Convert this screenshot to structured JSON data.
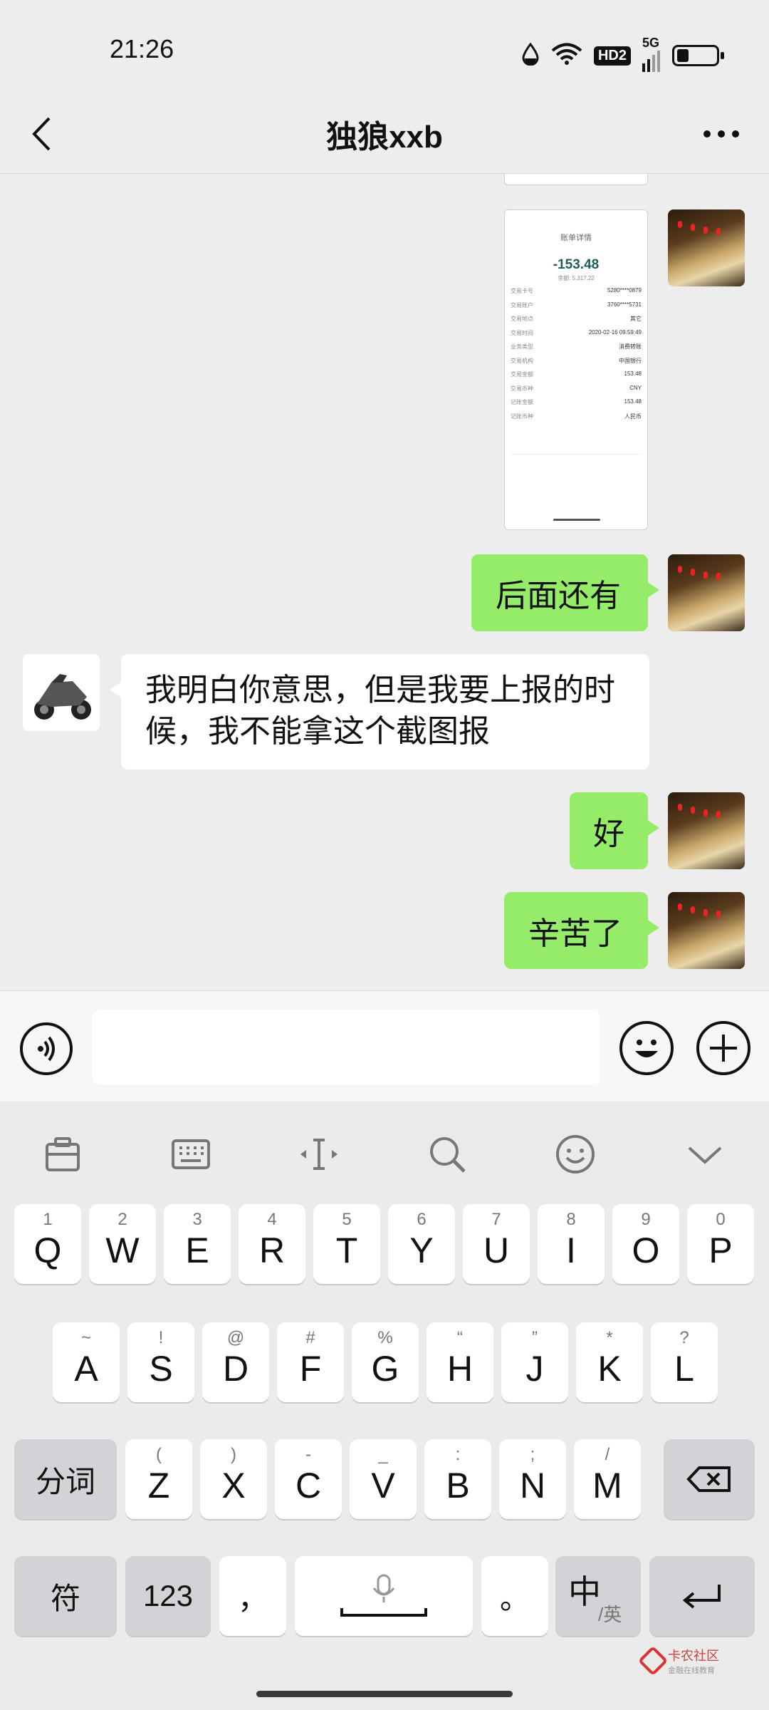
{
  "status_bar": {
    "time": "21:26",
    "hd_badge": "HD2",
    "network": "5G",
    "icons": [
      "drop-icon",
      "wifi-icon",
      "signal-icon",
      "battery-icon"
    ]
  },
  "header": {
    "title": "独狼xxb",
    "back_icon": "chevron-left-icon",
    "more_icon": "more-dots-icon"
  },
  "messages": [
    {
      "from": "me",
      "type": "image",
      "amount": "-153.48",
      "subamount": "余额: 5,317.22"
    },
    {
      "from": "me",
      "type": "text",
      "text": "后面还有"
    },
    {
      "from": "them",
      "type": "text",
      "text_line1": "我明白你意思，但是我要上报的时",
      "text_line2": "候，我不能拿这个截图报"
    },
    {
      "from": "me",
      "type": "text",
      "text": "好"
    },
    {
      "from": "me",
      "type": "text",
      "text": "辛苦了"
    }
  ],
  "screenshot_rows": [
    {
      "label": "交易卡号",
      "value": "5280****0879"
    },
    {
      "label": "交易账户",
      "value": "3760****5731"
    },
    {
      "label": "交易地点",
      "value": "其它"
    },
    {
      "label": "交易时间",
      "value": "2020-02-16 09:59:49"
    },
    {
      "label": "业务类型",
      "value": "消费转账"
    },
    {
      "label": "交易机构",
      "value": "中国银行"
    },
    {
      "label": "交易金额",
      "value": "153.48"
    },
    {
      "label": "交易币种",
      "value": "CNY"
    },
    {
      "label": "记账金额",
      "value": "153.48"
    },
    {
      "label": "记账币种",
      "value": "人民币"
    }
  ],
  "input_bar": {
    "placeholder": "",
    "voice_icon": "voice-icon",
    "emoji_icon": "emoji-icon",
    "plus_icon": "plus-icon"
  },
  "keyboard": {
    "toolbar": [
      "clipboard-icon",
      "keyboard-icon",
      "cursor-icon",
      "search-icon",
      "emoji-icon",
      "collapse-icon"
    ],
    "row1": [
      {
        "k": "Q",
        "h": "1"
      },
      {
        "k": "W",
        "h": "2"
      },
      {
        "k": "E",
        "h": "3"
      },
      {
        "k": "R",
        "h": "4"
      },
      {
        "k": "T",
        "h": "5"
      },
      {
        "k": "Y",
        "h": "6"
      },
      {
        "k": "U",
        "h": "7"
      },
      {
        "k": "I",
        "h": "8"
      },
      {
        "k": "O",
        "h": "9"
      },
      {
        "k": "P",
        "h": "0"
      }
    ],
    "row2": [
      {
        "k": "A",
        "h": "~"
      },
      {
        "k": "S",
        "h": "!"
      },
      {
        "k": "D",
        "h": "@"
      },
      {
        "k": "F",
        "h": "#"
      },
      {
        "k": "G",
        "h": "%"
      },
      {
        "k": "H",
        "h": "“"
      },
      {
        "k": "J",
        "h": "”"
      },
      {
        "k": "K",
        "h": "*"
      },
      {
        "k": "L",
        "h": "?"
      }
    ],
    "row3": [
      {
        "k": "Z",
        "h": "("
      },
      {
        "k": "X",
        "h": ")"
      },
      {
        "k": "C",
        "h": "-"
      },
      {
        "k": "V",
        "h": "_"
      },
      {
        "k": "B",
        "h": ":"
      },
      {
        "k": "N",
        "h": ";"
      },
      {
        "k": "M",
        "h": "/"
      }
    ],
    "segment_key": "分词",
    "symbol_key": "符",
    "num_key": "123",
    "comma_key": "，",
    "period_key": "。",
    "lang_key": "中",
    "lang_sub": "/英"
  },
  "watermark": {
    "title": "卡农社区",
    "subtitle": "金融在线教育"
  }
}
